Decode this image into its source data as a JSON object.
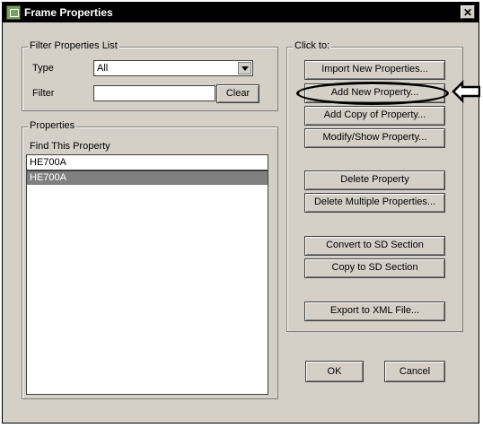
{
  "window": {
    "title": "Frame Properties"
  },
  "filter": {
    "legend": "Filter Properties List",
    "type_label": "Type",
    "type_value": "All",
    "filter_label": "Filter",
    "filter_value": "",
    "clear_label": "Clear"
  },
  "properties": {
    "legend": "Properties",
    "find_label": "Find This Property",
    "find_value": "HE700A",
    "items": [
      "HE700A"
    ]
  },
  "click_to": {
    "legend": "Click to:",
    "buttons": [
      "Import New Properties...",
      "Add New Property...",
      "Add Copy of Property...",
      "Modify/Show Property...",
      "Delete Property",
      "Delete Multiple Properties...",
      "Convert to SD Section",
      "Copy to SD Section",
      "Export to XML File..."
    ]
  },
  "footer": {
    "ok": "OK",
    "cancel": "Cancel"
  },
  "icons": {
    "app": "frame-properties-icon",
    "close": "close-icon",
    "dropdown": "chevron-down-icon",
    "annotation": "arrow-left-icon"
  }
}
